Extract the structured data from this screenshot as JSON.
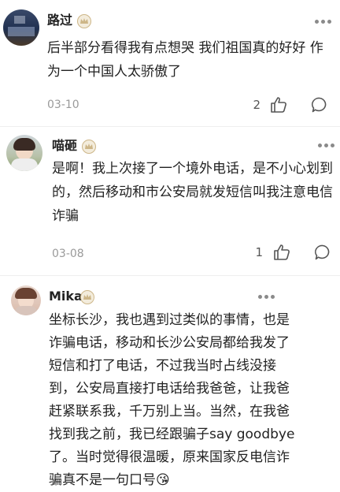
{
  "comments": [
    {
      "username": "路过",
      "text": "后半部分看得我有点想哭 我们祖国真的好好 作\n为一个中国人太骄傲了",
      "date": "03-10",
      "likes": "2"
    },
    {
      "username": "喵砸",
      "text": "是啊！我上次接了一个境外电话，是不小心划到\n的，然后移动和市公安局就发短信叫我注意电信\n诈骗",
      "date": "03-08",
      "likes": "1"
    },
    {
      "username": "Mika",
      "text": "坐标长沙，我也遇到过类似的事情，也是\n诈骗电话，移动和长沙公安局都给我发了\n短信和打了电话，不过我当时占线没接\n到，公安局直接打电话给我爸爸，让我爸\n赶紧联系我，千万别上当。当然，在我爸\n找到我之前，我已经跟骗子say goodbye\n了。当时觉得很温暖，原来国家反电信诈\n骗真不是一句口号",
      "emoji": "😘"
    }
  ],
  "icons": {
    "badge": "crown-badge-icon",
    "more": "more-dots-icon",
    "like": "thumbs-up-icon",
    "reply": "comment-bubble-icon"
  },
  "colors": {
    "badge": "#cdb688",
    "icon": "#555555",
    "date": "#9a9a9a"
  }
}
